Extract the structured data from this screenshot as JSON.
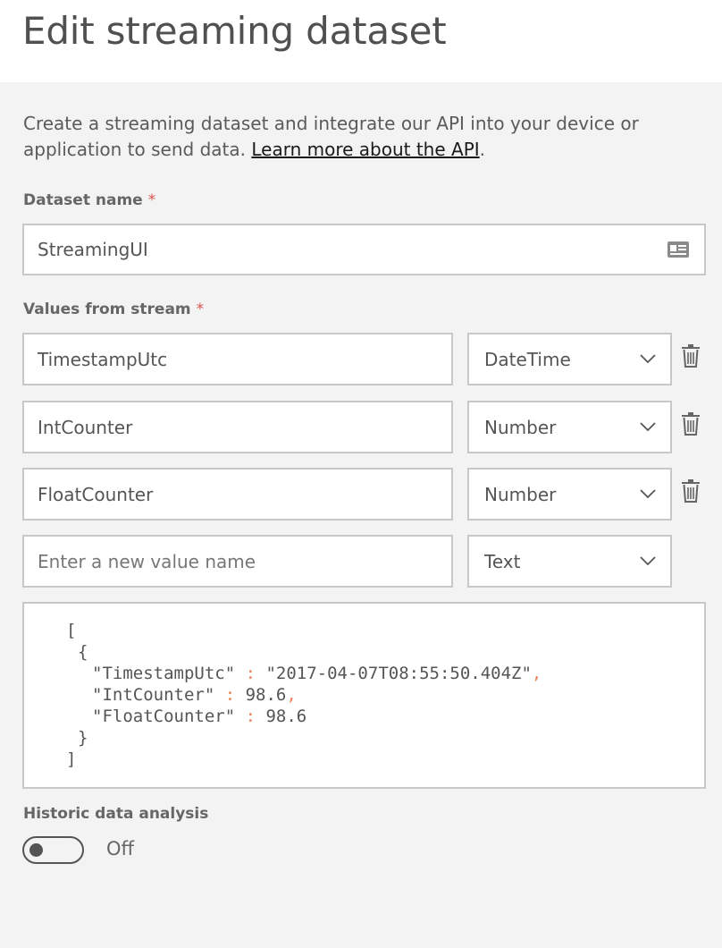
{
  "page": {
    "title": "Edit streaming dataset",
    "description_text": "Create a streaming dataset and integrate our API into your device or application to send data. ",
    "learn_more_link": "Learn more about the API",
    "description_end": "."
  },
  "dataset_name": {
    "label": "Dataset name",
    "required_mark": "*",
    "value": "StreamingUI",
    "icon": "contact-card-icon"
  },
  "values_from_stream": {
    "label": "Values from stream",
    "required_mark": "*",
    "rows": [
      {
        "name": "TimestampUtc",
        "type": "DateTime"
      },
      {
        "name": "IntCounter",
        "type": "Number"
      },
      {
        "name": "FloatCounter",
        "type": "Number"
      }
    ],
    "new_value": {
      "placeholder": "Enter a new value name",
      "type": "Text"
    }
  },
  "json_preview": {
    "line1": "[",
    "line2": "{",
    "line3_key": "\"TimestampUtc\"",
    "line3_sep": " : ",
    "line3_val": "\"2017-04-07T08:55:50.404Z\"",
    "line3_comma": ",",
    "line4_key": "\"IntCounter\"",
    "line4_sep": " : ",
    "line4_val": "98.6",
    "line4_comma": ",",
    "line5_key": "\"FloatCounter\"",
    "line5_sep": " : ",
    "line5_val": "98.6",
    "line6": "}",
    "line7": "]"
  },
  "historic": {
    "label": "Historic data analysis",
    "toggle_state": "Off"
  },
  "colors": {
    "accent_punctuation": "#e8845a",
    "required": "#d9534f"
  }
}
